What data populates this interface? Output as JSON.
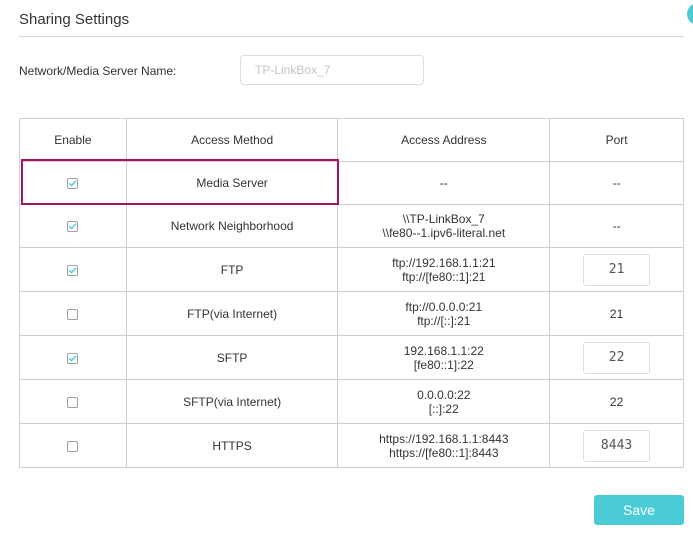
{
  "page": {
    "title": "Sharing Settings",
    "accent_color": "#4acbd6",
    "highlight_color": "#a4165f"
  },
  "server_name": {
    "label": "Network/Media Server Name:",
    "value": "TP-LinkBox_7"
  },
  "table": {
    "headers": {
      "enable": "Enable",
      "method": "Access Method",
      "address": "Access Address",
      "port": "Port"
    },
    "rows": [
      {
        "enabled": true,
        "method": "Media Server",
        "address": [
          "--"
        ],
        "port": "--",
        "port_editable": false
      },
      {
        "enabled": true,
        "method": "Network Neighborhood",
        "address": [
          "\\\\TP-LinkBox_7",
          "\\\\fe80--1.ipv6-literal.net"
        ],
        "port": "--",
        "port_editable": false
      },
      {
        "enabled": true,
        "method": "FTP",
        "address": [
          "ftp://192.168.1.1:21",
          "ftp://[fe80::1]:21"
        ],
        "port": "21",
        "port_editable": true
      },
      {
        "enabled": false,
        "method": "FTP(via Internet)",
        "address": [
          "ftp://0.0.0.0:21",
          "ftp://[::]:21"
        ],
        "port": "21",
        "port_editable": false
      },
      {
        "enabled": true,
        "method": "SFTP",
        "address": [
          "192.168.1.1:22",
          "[fe80::1]:22"
        ],
        "port": "22",
        "port_editable": true
      },
      {
        "enabled": false,
        "method": "SFTP(via Internet)",
        "address": [
          "0.0.0.0:22",
          "[::]:22"
        ],
        "port": "22",
        "port_editable": false
      },
      {
        "enabled": false,
        "method": "HTTPS",
        "address": [
          "https://192.168.1.1:8443",
          "https://[fe80::1]:8443"
        ],
        "port": "8443",
        "port_editable": true
      }
    ]
  },
  "actions": {
    "save_label": "Save"
  }
}
